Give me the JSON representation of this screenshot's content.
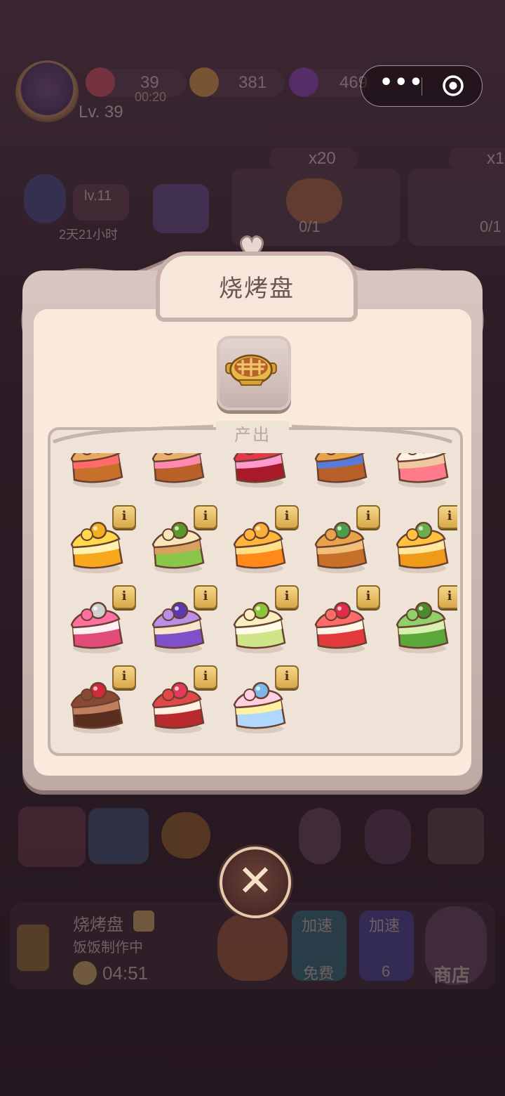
{
  "hud": {
    "energy_value": "39",
    "energy_timer": "00:20",
    "coins_value": "381",
    "gems_value": "469",
    "player_level": "Lv. 39",
    "event_level": "lv.11",
    "event_timer": "2天21小时",
    "order_reward_1": "x20",
    "order_reward_2": "x1",
    "order_progress_1": "0/1",
    "order_progress_2": "0/1"
  },
  "capsule": {
    "menu_icon": "more-dots-icon",
    "close_icon": "target-circle-icon"
  },
  "modal": {
    "title": "烧烤盘",
    "featured_item_icon": "baking-tray-icon",
    "output_label": "产出",
    "info_glyph": "i",
    "partial_row": [
      "strawberry-tart-icon",
      "pancake-stack-icon",
      "berry-jam-icon",
      "blueberry-pie-icon",
      "strawberry-shortcake-icon"
    ],
    "items": [
      {
        "name": "lemon-cake-icon"
      },
      {
        "name": "kiwi-cake-icon"
      },
      {
        "name": "orange-cake-icon"
      },
      {
        "name": "apple-pie-icon"
      },
      {
        "name": "mango-cake-icon"
      },
      {
        "name": "pink-cream-cake-icon"
      },
      {
        "name": "blueberry-cake-icon"
      },
      {
        "name": "lime-roll-cake-icon"
      },
      {
        "name": "strawberry-layer-cake-icon"
      },
      {
        "name": "matcha-cake-icon"
      },
      {
        "name": "chocolate-cherry-cake-icon"
      },
      {
        "name": "raspberry-cake-icon"
      },
      {
        "name": "rainbow-bird-cake-icon"
      }
    ]
  },
  "bottom": {
    "producer_name": "烧烤盘",
    "producer_status": "饭饭制作中",
    "producer_timer": "04:51",
    "speed_label": "加速",
    "speed_free": "免费",
    "speed_gem_cost": "6",
    "shop_label": "商店"
  },
  "close_button": {
    "icon": "close-x-icon"
  },
  "colors": {
    "panel_bg": "#fbe9dc",
    "frame": "#c9b0aa",
    "title_text": "#6c5550",
    "badge_gold": "#e8c26a",
    "backdrop": "#2a1a22"
  }
}
